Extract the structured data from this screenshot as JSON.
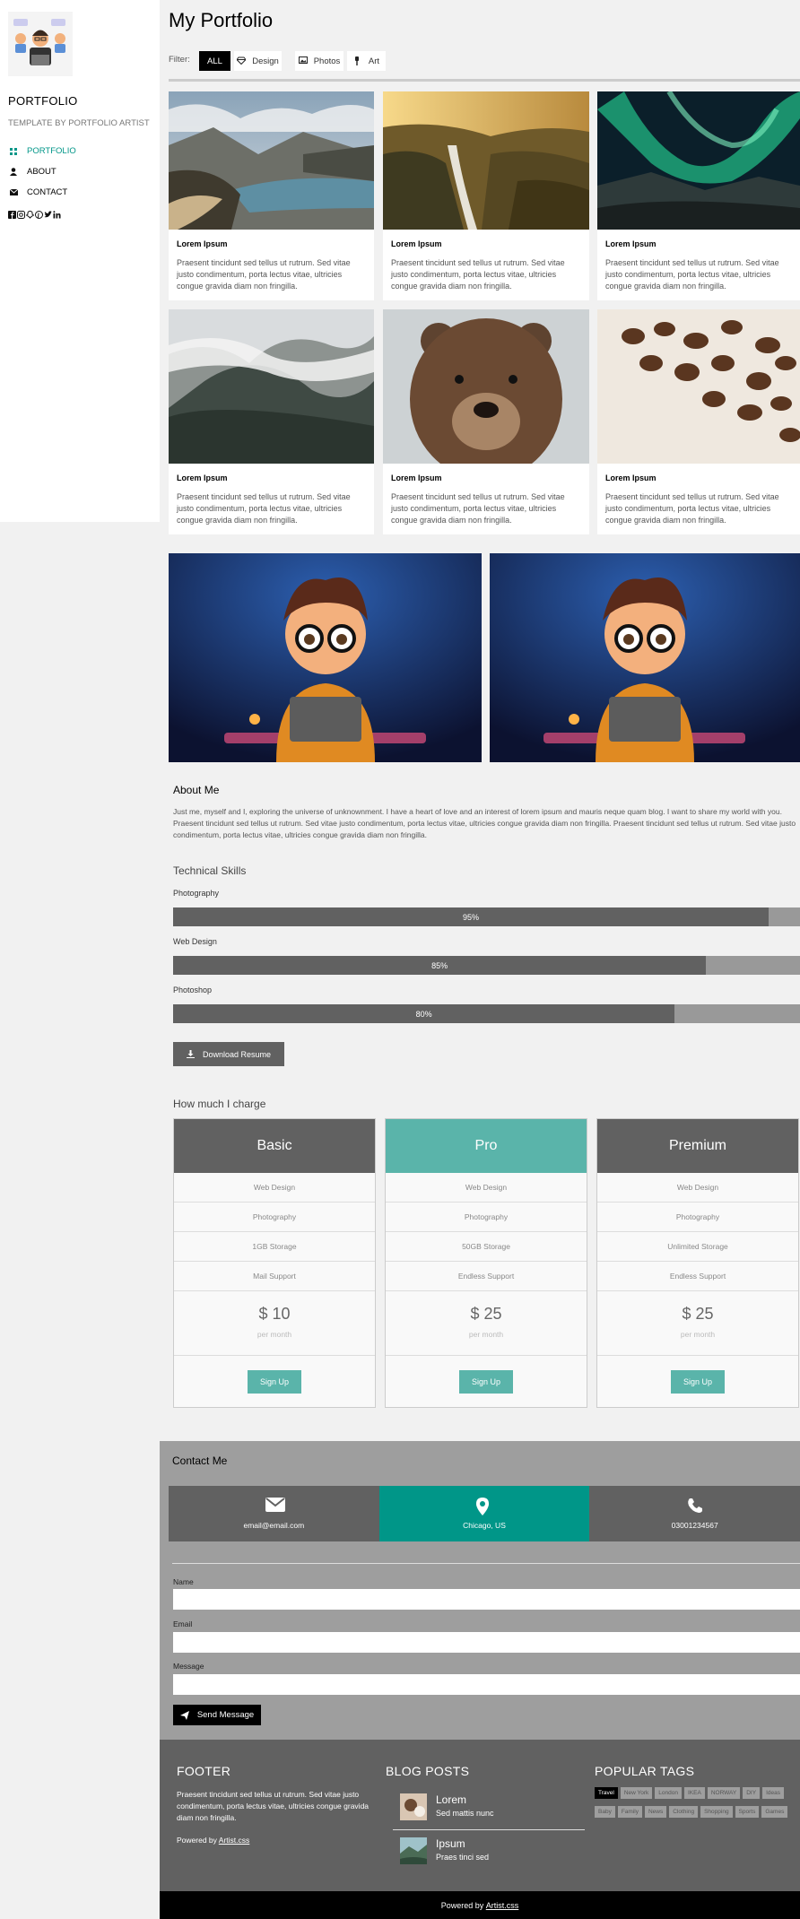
{
  "sidebar": {
    "brand": "PORTFOLIO",
    "tagline": "TEMPLATE BY PORTFOLIO ARTIST",
    "nav": [
      {
        "label": "PORTFOLIO",
        "icon": "grid-icon",
        "active": true
      },
      {
        "label": "ABOUT",
        "icon": "user-icon",
        "active": false
      },
      {
        "label": "CONTACT",
        "icon": "envelope-icon",
        "active": false
      }
    ],
    "socials": [
      "facebook-icon",
      "instagram-icon",
      "snapchat-icon",
      "pinterest-icon",
      "twitter-icon",
      "linkedin-icon"
    ]
  },
  "header": {
    "title": "My Portfolio"
  },
  "filter": {
    "label": "Filter:",
    "buttons": [
      {
        "label": "ALL",
        "active": true
      },
      {
        "label": "Design",
        "icon": "diamond-icon"
      },
      {
        "label": "Photos",
        "icon": "photo-icon"
      },
      {
        "label": "Art",
        "icon": "brush-icon"
      }
    ]
  },
  "cards": [
    {
      "title": "Lorem Ipsum",
      "text": "Praesent tincidunt sed tellus ut rutrum. Sed vitae justo condimentum, porta lectus vitae, ultricies congue gravida diam non fringilla.",
      "image": "mountain-lake"
    },
    {
      "title": "Lorem Ipsum",
      "text": "Praesent tincidunt sed tellus ut rutrum. Sed vitae justo condimentum, porta lectus vitae, ultricies congue gravida diam non fringilla.",
      "image": "waterfall"
    },
    {
      "title": "Lorem Ipsum",
      "text": "Praesent tincidunt sed tellus ut rutrum. Sed vitae justo condimentum, porta lectus vitae, ultricies congue gravida diam non fringilla.",
      "image": "northern-lights"
    },
    {
      "title": "Lorem Ipsum",
      "text": "Praesent tincidunt sed tellus ut rutrum. Sed vitae justo condimentum, porta lectus vitae, ultricies congue gravida diam non fringilla.",
      "image": "misty-mountain"
    },
    {
      "title": "Lorem Ipsum",
      "text": "Praesent tincidunt sed tellus ut rutrum. Sed vitae justo condimentum, porta lectus vitae, ultricies congue gravida diam non fringilla.",
      "image": "bear"
    },
    {
      "title": "Lorem Ipsum",
      "text": "Praesent tincidunt sed tellus ut rutrum. Sed vitae justo condimentum, porta lectus vitae, ultricies congue gravida diam non fringilla.",
      "image": "coffee-beans"
    }
  ],
  "about": {
    "title": "About Me",
    "text": "Just me, myself and I, exploring the universe of unknownment. I have a heart of love and an interest of lorem ipsum and mauris neque quam blog. I want to share my world with you. Praesent tincidunt sed tellus ut rutrum. Sed vitae justo condimentum, porta lectus vitae, ultricies congue gravida diam non fringilla. Praesent tincidunt sed tellus ut rutrum. Sed vitae justo condimentum, porta lectus vitae, ultricies congue gravida diam non fringilla."
  },
  "skills": {
    "title": "Technical Skills",
    "items": [
      {
        "label": "Photography",
        "percent": 95,
        "display": "95%"
      },
      {
        "label": "Web Design",
        "percent": 85,
        "display": "85%"
      },
      {
        "label": "Photoshop",
        "percent": 80,
        "display": "80%"
      }
    ],
    "download_label": "Download Resume"
  },
  "pricing": {
    "title": "How much I charge",
    "plans": [
      {
        "name": "Basic",
        "features": [
          "Web Design",
          "Photography",
          "1GB Storage",
          "Mail Support"
        ],
        "price": "$ 10",
        "period": "per month",
        "cta": "Sign Up",
        "highlight": false
      },
      {
        "name": "Pro",
        "features": [
          "Web Design",
          "Photography",
          "50GB Storage",
          "Endless Support"
        ],
        "price": "$ 25",
        "period": "per month",
        "cta": "Sign Up",
        "highlight": true
      },
      {
        "name": "Premium",
        "features": [
          "Web Design",
          "Photography",
          "Unlimited Storage",
          "Endless Support"
        ],
        "price": "$ 25",
        "period": "per month",
        "cta": "Sign Up",
        "highlight": false
      }
    ]
  },
  "contact": {
    "title": "Contact Me",
    "tiles": [
      {
        "icon": "envelope-icon",
        "label": "email@email.com"
      },
      {
        "icon": "map-marker-icon",
        "label": "Chicago, US"
      },
      {
        "icon": "phone-icon",
        "label": "03001234567"
      }
    ],
    "fields": [
      {
        "label": "Name",
        "value": ""
      },
      {
        "label": "Email",
        "value": ""
      },
      {
        "label": "Message",
        "value": ""
      }
    ],
    "send_label": "Send Message"
  },
  "footer": {
    "col1_title": "FOOTER",
    "col1_text": "Praesent tincidunt sed tellus ut rutrum. Sed vitae justo condimentum, porta lectus vitae, ultricies congue gravida diam non fringilla.",
    "powered_prefix": "Powered by",
    "powered_link": "Artist.css",
    "col2_title": "BLOG POSTS",
    "posts": [
      {
        "title": "Lorem",
        "subtitle": "Sed mattis nunc"
      },
      {
        "title": "Ipsum",
        "subtitle": "Praes tinci sed"
      }
    ],
    "col3_title": "POPULAR TAGS",
    "tags": [
      "Travel",
      "New York",
      "London",
      "IKEA",
      "NORWAY",
      "DIY",
      "Ideas",
      "Baby",
      "Family",
      "News",
      "Clothing",
      "Shopping",
      "Sports",
      "Games"
    ]
  },
  "bottom_bar": {
    "prefix": "Powered by",
    "link": "Artist.css"
  },
  "colors": {
    "accent": "#009688",
    "teal": "#5ab4aa",
    "dark": "#616161",
    "grey": "#9e9e9e"
  }
}
